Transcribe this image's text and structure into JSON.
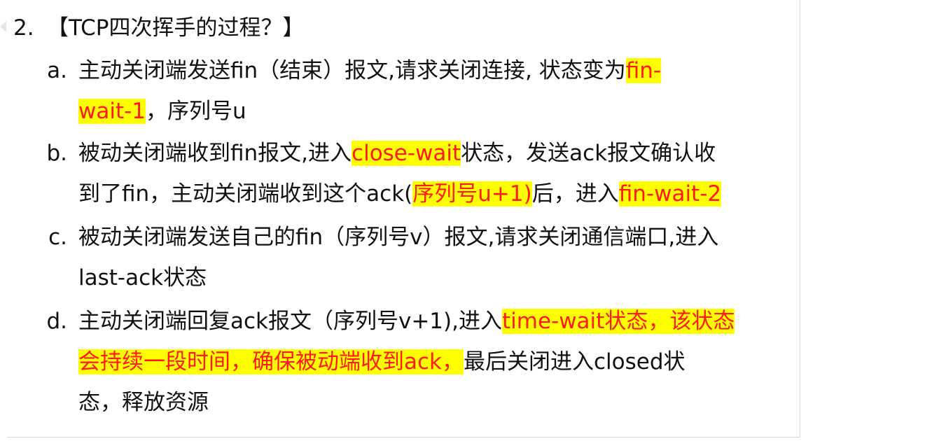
{
  "heading": {
    "number": "2.",
    "text": "【TCP四次挥手的过程？】"
  },
  "items": [
    {
      "marker": "a.",
      "line1_text": "主动关闭端发送fin（结束）报文,请求关闭连接, 状态变为",
      "line1_highlight": "fin-",
      "line2_highlight": "wait-1",
      "line2_text": "，序列号u"
    },
    {
      "marker": "b.",
      "line1_text_a": "被动关闭端收到fin报文,进入",
      "line1_highlight": "close-wait",
      "line1_text_b": "状态，发送ack报文确认收",
      "line2_text_a": "到了fin，主动关闭端收到这个ack",
      "line2_paren_open": "(",
      "line2_red_inline": "序列号u+1)",
      "line2_text_b": "后，进入",
      "line2_highlight": "fin-wait-2"
    },
    {
      "marker": "c.",
      "line1_text": "被动关闭端发送自己的fin（序列号v）报文,请求关闭通信端口,进入",
      "line2_text": "last-ack状态"
    },
    {
      "marker": "d.",
      "line1_text": "主动关闭端回复ack报文（序列号v+1),进入",
      "line1_highlight": "time-wait状态，该状态",
      "line2_highlight": "会持续一段时间，确保被动端收到ack，",
      "line2_text": "最后关闭进入closed状",
      "line3_text": "态，释放资源"
    }
  ],
  "colors": {
    "highlight_bg": "#ffff00",
    "highlight_text": "#ff1a1a",
    "body_text": "#111111"
  }
}
